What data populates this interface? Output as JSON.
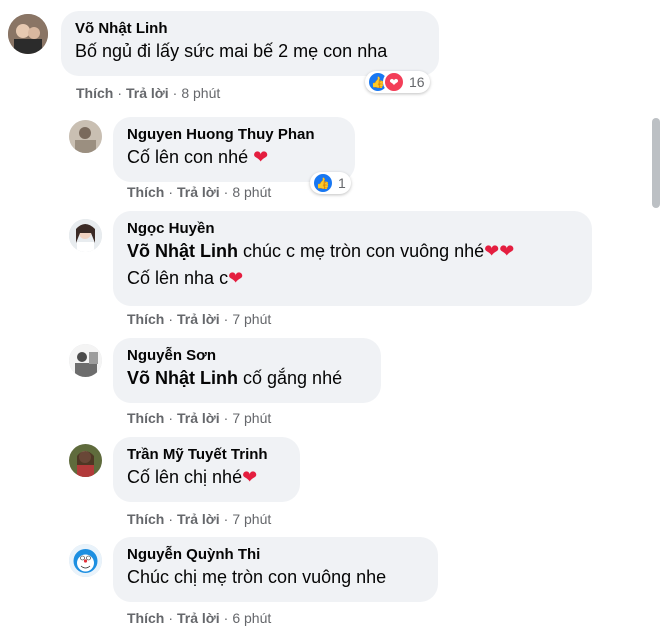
{
  "actions": {
    "like": "Thích",
    "reply": "Trả lời",
    "separator": "·"
  },
  "colors": {
    "bubble": "#f0f2f5",
    "like": "#1877f2",
    "love": "#f33e58",
    "meta": "#65676b"
  },
  "comments": [
    {
      "author": "Võ Nhật Linh",
      "lines": [
        {
          "mention": "",
          "text": "Bố ngủ đi lấy sức mai bế 2 mẹ con nha",
          "hearts": ""
        }
      ],
      "time": "8 phút",
      "reactions": {
        "icons": [
          "like",
          "love"
        ],
        "count": "16"
      }
    },
    {
      "author": "Nguyen Huong Thuy Phan",
      "lines": [
        {
          "mention": "",
          "text": "Cố lên con nhé",
          "hearts": "❤"
        }
      ],
      "time": "8 phút",
      "reactions": {
        "icons": [
          "like"
        ],
        "count": "1"
      }
    },
    {
      "author": "Ngọc Huyền",
      "lines": [
        {
          "mention": "Võ Nhật Linh",
          "text": " chúc c mẹ tròn con vuông nhé",
          "hearts": "❤❤"
        },
        {
          "mention": "",
          "text": "Cố lên nha c",
          "hearts": "❤"
        }
      ],
      "time": "7 phút",
      "reactions": null
    },
    {
      "author": "Nguyễn Sơn",
      "lines": [
        {
          "mention": "Võ Nhật Linh",
          "text": " cố gắng nhé",
          "hearts": ""
        }
      ],
      "time": "7 phút",
      "reactions": null
    },
    {
      "author": "Trần Mỹ Tuyết Trinh",
      "lines": [
        {
          "mention": "",
          "text": "Cố lên chị nhé",
          "hearts": "❤"
        }
      ],
      "time": "7 phút",
      "reactions": null
    },
    {
      "author": "Nguyễn Quỳnh Thi",
      "lines": [
        {
          "mention": "",
          "text": "Chúc chị mẹ tròn con vuông nhe",
          "hearts": ""
        }
      ],
      "time": "6 phút",
      "reactions": null
    }
  ]
}
